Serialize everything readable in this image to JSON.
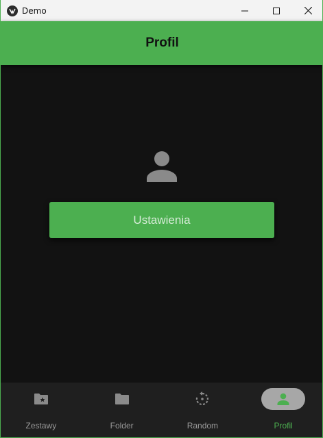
{
  "window": {
    "title": "Demo"
  },
  "header": {
    "title": "Profil"
  },
  "main": {
    "settings_label": "Ustawienia"
  },
  "bottom_nav": {
    "items": [
      {
        "label": "Zestawy",
        "icon": "folder-star-icon"
      },
      {
        "label": "Folder",
        "icon": "folder-icon"
      },
      {
        "label": "Random",
        "icon": "rotate-icon"
      },
      {
        "label": "Profil",
        "icon": "person-icon"
      }
    ],
    "active_index": 3
  },
  "colors": {
    "accent": "#4caf50",
    "background": "#121212",
    "nav_background": "#1f1f1f",
    "icon_inactive": "#8a8a8a"
  }
}
